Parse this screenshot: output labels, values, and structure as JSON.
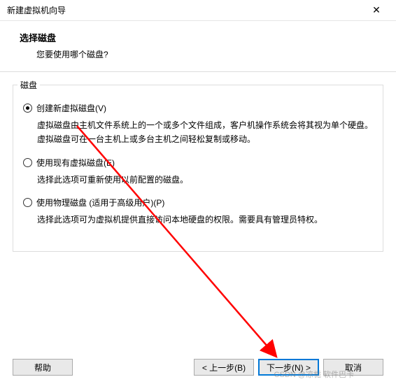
{
  "window": {
    "title": "新建虚拟机向导",
    "close_glyph": "✕"
  },
  "header": {
    "heading": "选择磁盘",
    "subheading": "您要使用哪个磁盘?"
  },
  "fieldset": {
    "legend": "磁盘"
  },
  "options": [
    {
      "label": "创建新虚拟磁盘(V)",
      "desc": "虚拟磁盘由主机文件系统上的一个或多个文件组成，客户机操作系统会将其视为单个硬盘。虚拟磁盘可在一台主机上或多台主机之间轻松复制或移动。",
      "checked": true
    },
    {
      "label": "使用现有虚拟磁盘(E)",
      "desc": "选择此选项可重新使用以前配置的磁盘。",
      "checked": false
    },
    {
      "label": "使用物理磁盘 (适用于高级用户)(P)",
      "desc": "选择此选项可为虚拟机提供直接访问本地硬盘的权限。需要具有管理员特权。",
      "checked": false
    }
  ],
  "buttons": {
    "help": "帮助",
    "back": "< 上一步(B)",
    "next": "下一步(N) >",
    "cancel": "取消"
  },
  "watermark": "CSDN @凉栀 软件巴卡"
}
